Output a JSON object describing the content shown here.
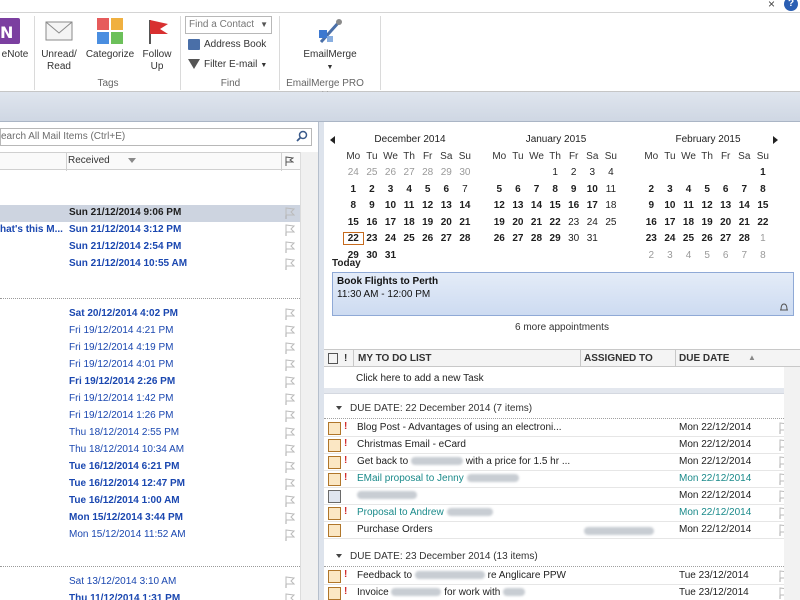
{
  "ribbon": {
    "onenote_label": "eNote",
    "unread_label": "Unread/\nRead",
    "categorize_label": "Categorize",
    "followup_label": "Follow\nUp",
    "tags_group": "Tags",
    "find_contact": "Find a Contact",
    "address_book": "Address Book",
    "filter_email": "Filter E-mail",
    "find_group": "Find",
    "emailmerge_label": "EmailMerge",
    "emailmerge_group": "EmailMerge PRO"
  },
  "mail": {
    "search_placeholder": "earch All Mail Items (Ctrl+E)",
    "col_received": "Received",
    "rows": [
      {
        "subject": "",
        "date": "Sun 21/12/2014 9:06 PM"
      },
      {
        "subject": "hat's this M...",
        "date": "Sun 21/12/2014 3:12 PM"
      },
      {
        "subject": "",
        "date": "Sun 21/12/2014 2:54 PM"
      },
      {
        "subject": "",
        "date": "Sun 21/12/2014 10:55 AM"
      },
      {
        "subject": "",
        "date": "Sat 20/12/2014 4:02 PM"
      },
      {
        "subject": "",
        "date": "Fri 19/12/2014 4:21 PM"
      },
      {
        "subject": "",
        "date": "Fri 19/12/2014 4:19 PM"
      },
      {
        "subject": "",
        "date": "Fri 19/12/2014 4:01 PM"
      },
      {
        "subject": "",
        "date": "Fri 19/12/2014 2:26 PM"
      },
      {
        "subject": "",
        "date": "Fri 19/12/2014 1:42 PM"
      },
      {
        "subject": "",
        "date": "Fri 19/12/2014 1:26 PM"
      },
      {
        "subject": "",
        "date": "Thu 18/12/2014 2:55 PM"
      },
      {
        "subject": "",
        "date": "Thu 18/12/2014 10:34 AM"
      },
      {
        "subject": "",
        "date": "Tue 16/12/2014 6:21 PM"
      },
      {
        "subject": "",
        "date": "Tue 16/12/2014 12:47 PM"
      },
      {
        "subject": "",
        "date": "Tue 16/12/2014 1:00 AM"
      },
      {
        "subject": "",
        "date": "Mon 15/12/2014 3:44 PM"
      },
      {
        "subject": "",
        "date": "Mon 15/12/2014 11:52 AM"
      },
      {
        "subject": "",
        "date": "Sat 13/12/2014 3:10 AM"
      },
      {
        "subject": "",
        "date": "Thu 11/12/2014 1:31 PM"
      }
    ]
  },
  "calendar": {
    "months": [
      {
        "title": "December 2014"
      },
      {
        "title": "January 2015"
      },
      {
        "title": "February 2015"
      }
    ],
    "weekdays": [
      "Mo",
      "Tu",
      "We",
      "Th",
      "Fr",
      "Sa",
      "Su"
    ],
    "today_label": "Today",
    "appointment_title": "Book Flights to Perth",
    "appointment_time": "11:30 AM - 12:00 PM",
    "more_appointments": "6 more appointments"
  },
  "todo": {
    "col_list": "MY TO DO LIST",
    "col_assigned": "ASSIGNED TO",
    "col_due": "DUE DATE",
    "new_task": "Click here to add a new Task",
    "group1": "DUE DATE: 22 December 2014 (7 items)",
    "group2": "DUE DATE: 23 December 2014 (13 items)",
    "tasks": [
      {
        "name": "Blog Post - Advantages of using an electroni...",
        "due": "Mon 22/12/2014"
      },
      {
        "name": "Christmas Email - eCard",
        "due": "Mon 22/12/2014"
      },
      {
        "name": "Get back to",
        "name_end": "with a price for 1.5 hr ...",
        "due": "Mon 22/12/2014"
      },
      {
        "name": "EMail proposal to Jenny",
        "due": "Mon 22/12/2014"
      },
      {
        "name": "",
        "due": "Mon 22/12/2014"
      },
      {
        "name": "Proposal to Andrew",
        "due": "Mon 22/12/2014"
      },
      {
        "name": "Purchase Orders",
        "due": "Mon 22/12/2014"
      },
      {
        "name": "Feedback to",
        "name_end": "re Anglicare PPW",
        "due": "Tue 23/12/2014"
      },
      {
        "name": "Invoice",
        "name_end": "for work with",
        "due": "Tue 23/12/2014"
      }
    ]
  }
}
